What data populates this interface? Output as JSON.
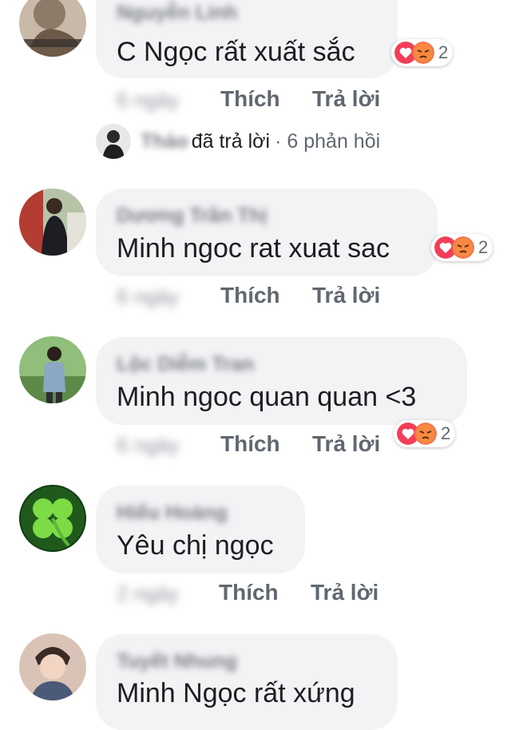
{
  "colors": {
    "love": "#f33e58",
    "angry": "#f7714b",
    "bubble": "#f2f3f5"
  },
  "comments": [
    {
      "name": "Nguyễn Linh",
      "text": "C Ngọc rất xuất sắc",
      "reactions": {
        "icons": [
          "love-icon",
          "angry-icon"
        ],
        "count": "2"
      },
      "time": "6 ngày",
      "like": "Thích",
      "reply": "Trả lời"
    },
    {
      "name": "Dương Trần Thị",
      "text": "Minh ngoc rat xuat sac",
      "reactions": {
        "icons": [
          "love-icon",
          "angry-icon"
        ],
        "count": "2"
      },
      "time": "6 ngày",
      "like": "Thích",
      "reply": "Trả lời"
    },
    {
      "name": "Lộc Diễm Tran",
      "text": "Minh ngoc quan quan <3",
      "reactions": {
        "icons": [
          "love-icon",
          "angry-icon"
        ],
        "count": "2"
      },
      "time": "6 ngày",
      "like": "Thích",
      "reply": "Trả lời"
    },
    {
      "name": "Hiếu Hoàng",
      "text": "Yêu chị ngọc",
      "time": "2 ngày",
      "like": "Thích",
      "reply": "Trả lời"
    },
    {
      "name": "Tuyết Nhung",
      "text": "Minh Ngọc rất xứng"
    }
  ],
  "replies_summary": {
    "name": "Thảo",
    "verb": "đã trả lời",
    "count": "· 6 phản hồi"
  }
}
